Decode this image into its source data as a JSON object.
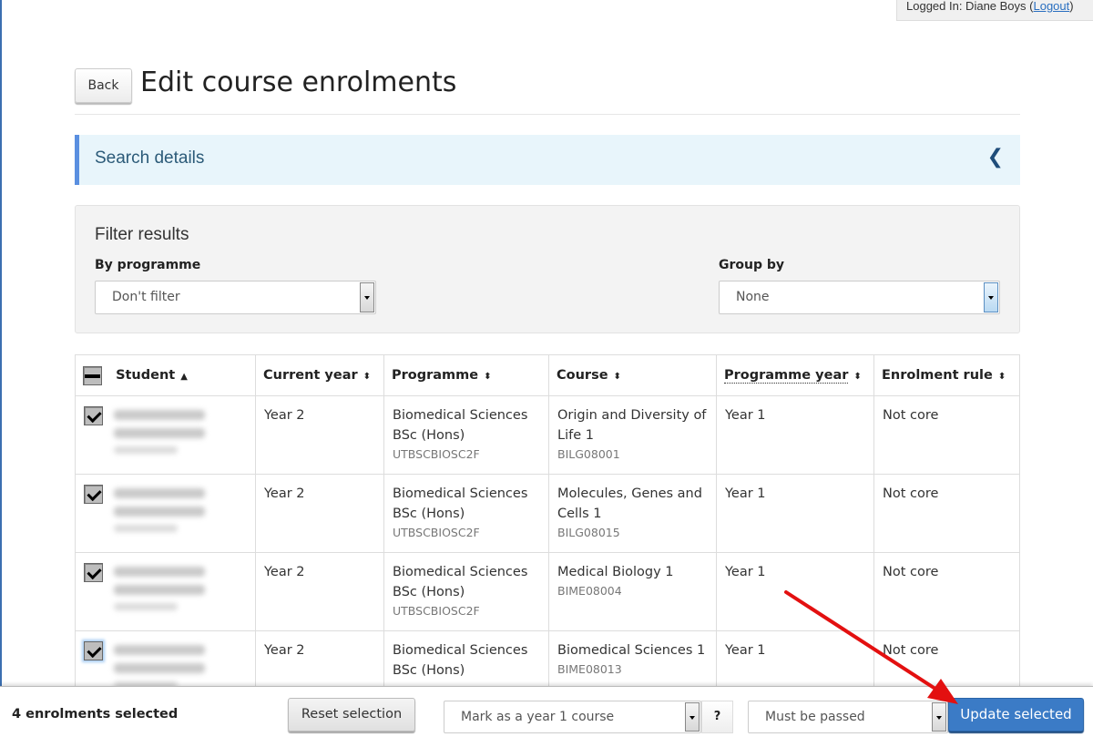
{
  "login": {
    "prefix": "Logged In: Diane Boys (",
    "logout_label": "Logout",
    "suffix": ")"
  },
  "header": {
    "back_label": "Back",
    "title": "Edit course enrolments"
  },
  "search_panel": {
    "title": "Search details",
    "toggle_icon": "chevron-left-icon"
  },
  "filter": {
    "title": "Filter results",
    "by_programme": {
      "label": "By programme",
      "value": "Don't filter"
    },
    "group_by": {
      "label": "Group by",
      "value": "None"
    }
  },
  "table": {
    "columns": [
      {
        "label": "Student",
        "sort": "ascending"
      },
      {
        "label": "Current year",
        "sort": "sortable"
      },
      {
        "label": "Programme",
        "sort": "sortable"
      },
      {
        "label": "Course",
        "sort": "sortable"
      },
      {
        "label": "Programme year",
        "sort": "sortable"
      },
      {
        "label": "Enrolment rule",
        "sort": "sortable"
      }
    ],
    "select_all_state": "partial",
    "rows": [
      {
        "checked": true,
        "student": "[redacted]",
        "current_year": "Year 2",
        "programme": "Biomedical Sciences BSc (Hons)",
        "programme_code": "UTBSCBIOSC2F",
        "course": "Origin and Diversity of Life 1",
        "course_code": "BILG08001",
        "programme_year": "Year 1",
        "enrolment_rule": "Not core"
      },
      {
        "checked": true,
        "student": "[redacted]",
        "current_year": "Year 2",
        "programme": "Biomedical Sciences BSc (Hons)",
        "programme_code": "UTBSCBIOSC2F",
        "course": "Molecules, Genes and Cells 1",
        "course_code": "BILG08015",
        "programme_year": "Year 1",
        "enrolment_rule": "Not core"
      },
      {
        "checked": true,
        "student": "[redacted]",
        "current_year": "Year 2",
        "programme": "Biomedical Sciences BSc (Hons)",
        "programme_code": "UTBSCBIOSC2F",
        "course": "Medical Biology 1",
        "course_code": "BIME08004",
        "programme_year": "Year 1",
        "enrolment_rule": "Not core"
      },
      {
        "checked": true,
        "student": "[redacted]",
        "current_year": "Year 2",
        "programme": "Biomedical Sciences BSc (Hons)",
        "programme_code": "",
        "course": "Biomedical Sciences 1",
        "course_code": "BIME08013",
        "programme_year": "Year 1",
        "enrolment_rule": "Not core"
      }
    ]
  },
  "footer": {
    "selection_count": "4 enrolments selected",
    "reset_label": "Reset selection",
    "action_select": "Mark as a year 1 course",
    "help_label": "?",
    "rule_select": "Must be passed",
    "update_label": "Update selected"
  },
  "colors": {
    "accent": "#3b7bc6",
    "panel_border": "#5a8fe0",
    "annotation_arrow": "#e31010"
  }
}
